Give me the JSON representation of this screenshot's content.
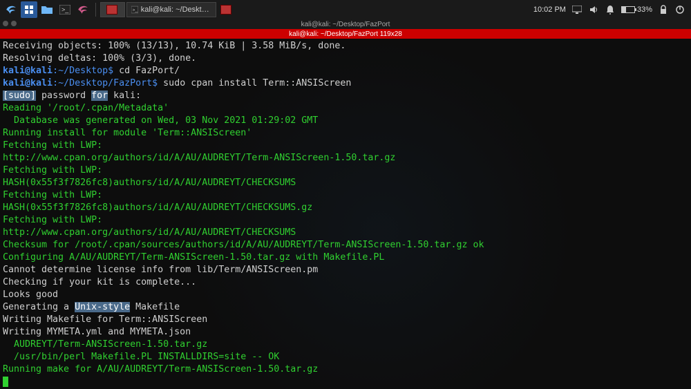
{
  "panel": {
    "task1": "",
    "task2": "kali@kali: ~/Desktop/Fa...",
    "clock": "10:02 PM",
    "battery_pct": "33%",
    "battery_fill_css": "width:33%"
  },
  "titlebar": "kali@kali: ~/Desktop/FazPort",
  "tabbar": "kali@kali: ~/Desktop/FazPort 119x28",
  "lines": {
    "l1": "Receiving objects: 100% (13/13), 10.74 KiB | 3.58 MiB/s, done.",
    "l2": "Resolving deltas: 100% (3/3), done.",
    "l3_user": "kali@kali",
    "l3_path": ":~/Desktop$",
    "l3_cmd": " cd FazPort/",
    "l4_user": "kali@kali",
    "l4_path": ":~/Desktop/FazPort$",
    "l4_cmd": " sudo cpan install Term::ANSIScreen",
    "l5a": "[sudo]",
    "l5b": " password ",
    "l5c": "for",
    "l5d": " kali:",
    "l6": "Reading '/root/.cpan/Metadata'",
    "l7": "  Database was generated on Wed, 03 Nov 2021 01:29:02 GMT",
    "l8": "Running install for module 'Term::ANSIScreen'",
    "l9": "Fetching with LWP:",
    "l10": "http://www.cpan.org/authors/id/A/AU/AUDREYT/Term-ANSIScreen-1.50.tar.gz",
    "l11": "Fetching with LWP:",
    "l12": "HASH(0x55f3f7826fc8)authors/id/A/AU/AUDREYT/CHECKSUMS",
    "l13": "Fetching with LWP:",
    "l14": "HASH(0x55f3f7826fc8)authors/id/A/AU/AUDREYT/CHECKSUMS.gz",
    "l15": "Fetching with LWP:",
    "l16": "http://www.cpan.org/authors/id/A/AU/AUDREYT/CHECKSUMS",
    "l17": "Checksum for /root/.cpan/sources/authors/id/A/AU/AUDREYT/Term-ANSIScreen-1.50.tar.gz ok",
    "l18": "Configuring A/AU/AUDREYT/Term-ANSIScreen-1.50.tar.gz with Makefile.PL",
    "l19": "Cannot determine license info from lib/Term/ANSIScreen.pm",
    "l20": "Checking if your kit is complete...",
    "l21": "Looks good",
    "l22a": "Generating a ",
    "l22b": "Unix-style",
    "l22c": " Makefile",
    "l23": "Writing Makefile for Term::ANSIScreen",
    "l24": "Writing MYMETA.yml and MYMETA.json",
    "l25": "  AUDREYT/Term-ANSIScreen-1.50.tar.gz",
    "l26": "  /usr/bin/perl Makefile.PL INSTALLDIRS=site -- OK",
    "l27": "Running make for A/AU/AUDREYT/Term-ANSIScreen-1.50.tar.gz"
  }
}
